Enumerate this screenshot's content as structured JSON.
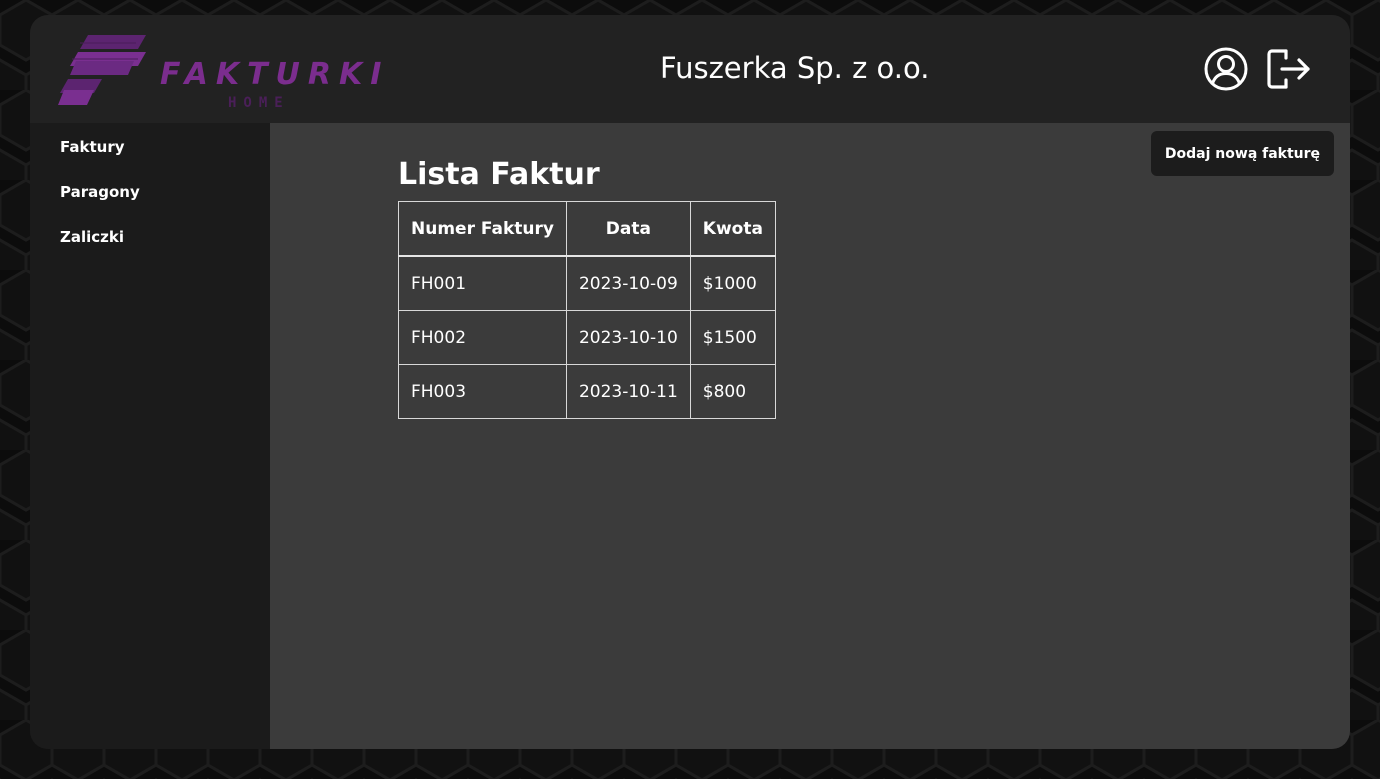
{
  "logo": {
    "title": "FAKTURKI",
    "subtitle": "HOME",
    "color": "#7b2d8e"
  },
  "header": {
    "company": "Fuszerka Sp. z o.o.",
    "user_icon": "user-circle-icon",
    "logout_icon": "logout-icon"
  },
  "sidebar": {
    "items": [
      {
        "label": "Faktury"
      },
      {
        "label": "Paragony"
      },
      {
        "label": "Zaliczki"
      }
    ]
  },
  "main": {
    "add_button": "Dodaj nową fakturę",
    "title": "Lista Faktur",
    "table": {
      "headers": [
        "Numer Faktury",
        "Data",
        "Kwota"
      ],
      "rows": [
        [
          "FH001",
          "2023-10-09",
          "$1000"
        ],
        [
          "FH002",
          "2023-10-10",
          "$1500"
        ],
        [
          "FH003",
          "2023-10-11",
          "$800"
        ]
      ]
    }
  },
  "colors": {
    "background": "#0c0c0c",
    "header": "#222222",
    "sidebar": "#1b1b1b",
    "content": "#3b3b3b",
    "accent": "#7b2d8e"
  }
}
